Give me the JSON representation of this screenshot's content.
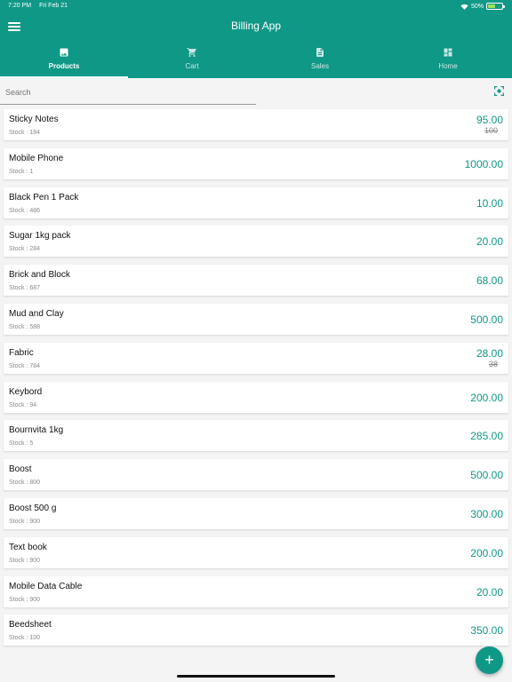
{
  "status_bar": {
    "time": "7:20 PM",
    "date": "Fri Feb 21",
    "battery": "50%",
    "battery_level": 0.5
  },
  "header": {
    "title": "Billing App",
    "menu_icon": "hamburger-menu-icon"
  },
  "tabs": [
    {
      "label": "Products",
      "icon": "image-icon",
      "active": true
    },
    {
      "label": "Cart",
      "icon": "cart-icon",
      "active": false
    },
    {
      "label": "Sales",
      "icon": "document-icon",
      "active": false
    },
    {
      "label": "Home",
      "icon": "dashboard-icon",
      "active": false
    }
  ],
  "search": {
    "placeholder": "Search",
    "value": "",
    "scan_icon": "scan-icon"
  },
  "colors": {
    "primary": "#109887",
    "background": "#f4f4f4",
    "card": "#ffffff"
  },
  "products": [
    {
      "name": "Sticky Notes",
      "stock": "Stock : 184",
      "price": "95.00",
      "old_price": "100"
    },
    {
      "name": "Mobile Phone",
      "stock": "Stock : 1",
      "price": "1000.00"
    },
    {
      "name": "Black Pen 1 Pack",
      "stock": "Stock : 486",
      "price": "10.00"
    },
    {
      "name": "Sugar 1kg pack",
      "stock": "Stock : 284",
      "price": "20.00"
    },
    {
      "name": "Brick and Block",
      "stock": "Stock : 687",
      "price": "68.00"
    },
    {
      "name": "Mud and Clay",
      "stock": "Stock : 588",
      "price": "500.00"
    },
    {
      "name": "Fabric",
      "stock": "Stock : 784",
      "price": "28.00",
      "old_price": "38"
    },
    {
      "name": "Keybord",
      "stock": "Stock : 94",
      "price": "200.00"
    },
    {
      "name": "Bournvita 1kg",
      "stock": "Stock : 5",
      "price": "285.00"
    },
    {
      "name": "Boost",
      "stock": "Stock : 800",
      "price": "500.00"
    },
    {
      "name": "Boost 500 g",
      "stock": "Stock : 900",
      "price": "300.00"
    },
    {
      "name": "Text book",
      "stock": "Stock : 900",
      "price": "200.00"
    },
    {
      "name": "Mobile Data Cable",
      "stock": "Stock : 900",
      "price": "20.00"
    },
    {
      "name": "Beedsheet",
      "stock": "Stock : 100",
      "price": "350.00"
    }
  ],
  "fab": {
    "label": "+",
    "icon": "add-icon"
  }
}
